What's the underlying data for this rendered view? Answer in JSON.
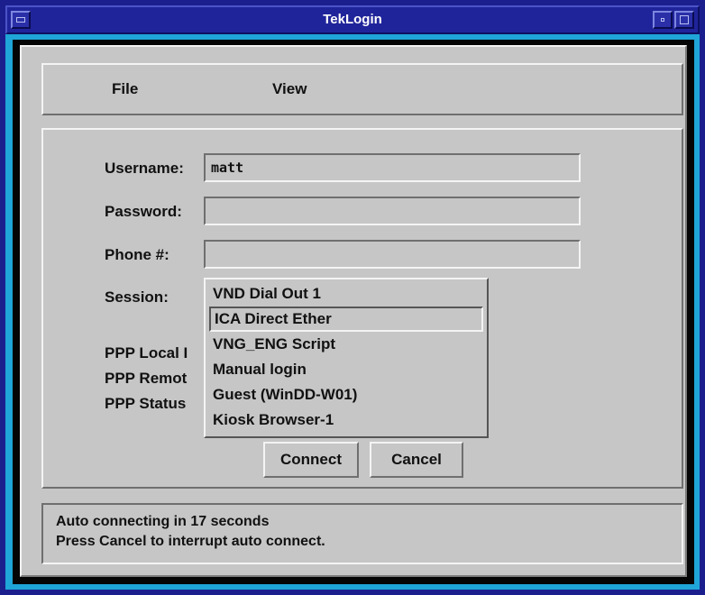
{
  "window": {
    "title": "TekLogin"
  },
  "menubar": {
    "items": [
      {
        "label": "File"
      },
      {
        "label": "View"
      }
    ]
  },
  "form": {
    "username": {
      "label": "Username:",
      "value": "matt"
    },
    "password": {
      "label": "Password:",
      "value": ""
    },
    "phone": {
      "label": "Phone #:",
      "value": ""
    },
    "session": {
      "label": "Session:",
      "selected": "ICA Direct Ether",
      "options": [
        {
          "label": "VND Dial Out 1"
        },
        {
          "label": "ICA Direct Ether"
        },
        {
          "label": "VNG_ENG Script"
        },
        {
          "label": "Manual login"
        },
        {
          "label": "Guest (WinDD-W01)"
        },
        {
          "label": "Kiosk Browser-1"
        }
      ]
    },
    "ppp_local_label": "PPP Local I",
    "ppp_remote_label": "PPP Remot",
    "ppp_status_label": "PPP Status"
  },
  "buttons": {
    "connect": "Connect",
    "cancel": "Cancel"
  },
  "status": {
    "line1": "Auto connecting in 17 seconds",
    "line2": "Press Cancel to interrupt auto connect."
  }
}
